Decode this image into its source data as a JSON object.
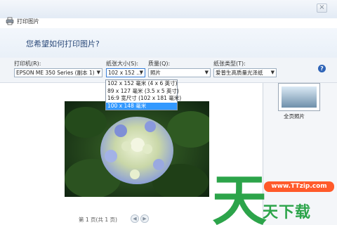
{
  "window": {
    "title": "打印图片",
    "close_symbol": "×",
    "question": "您希望如何打印图片?"
  },
  "options": {
    "printer_label": "打印机(R):",
    "printer_value": "EPSON ME 350 Series (副本 1)",
    "size_label": "纸张大小(S):",
    "size_value": "102 x 152 ...",
    "quality_label": "质量(Q):",
    "quality_value": "照片",
    "type_label": "纸张类型(T):",
    "type_value": "爱普生高质量光泽纸",
    "help_symbol": "?"
  },
  "size_dropdown": {
    "items": [
      "102 x 152 毫米 (4 x 6 英寸)",
      "89 x 127 毫米 (3.5 x 5 英寸)",
      "16:9 宽尺寸 (102 x 181 毫米)",
      "100 x 148 毫米"
    ],
    "selected_index": 3
  },
  "preview": {
    "pager_text": "第 1 页(共 1 页)",
    "prev_symbol": "◀",
    "next_symbol": "▶"
  },
  "layout": {
    "label": "全页照片"
  },
  "watermark": {
    "url": "www.TTzip.com",
    "text": "天下载"
  },
  "colors": {
    "accent": "#3399ff",
    "heading_text": "#2b4a7a",
    "watermark_green": "#2ca44a",
    "watermark_orange": "#ff5a2a"
  }
}
